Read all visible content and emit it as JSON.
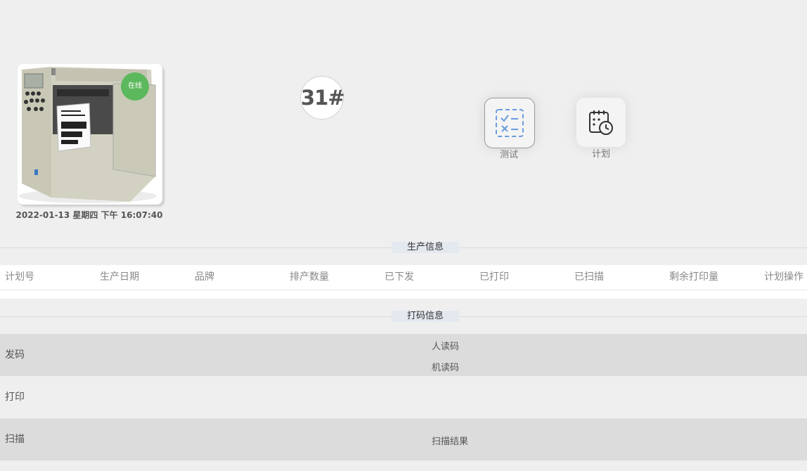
{
  "device": {
    "status": "在线",
    "datetime": "2022-01-13 星期四 下午 16:07:40",
    "machine_no": "31#"
  },
  "actions": [
    {
      "label": "测试",
      "icon": "checklist-icon"
    },
    {
      "label": "计划",
      "icon": "calendar-clock-icon"
    }
  ],
  "production": {
    "title": "生产信息",
    "columns": [
      "计划号",
      "生产日期",
      "品牌",
      "排产数量",
      "已下发",
      "已打印",
      "已扫描",
      "剩余打印量",
      "计划操作"
    ]
  },
  "coding": {
    "title": "打码信息",
    "rows": [
      {
        "label": "发码",
        "subs": [
          "人读码",
          "机读码"
        ]
      },
      {
        "label": "打印",
        "subs": []
      },
      {
        "label": "扫描",
        "subs": [
          "扫描结果"
        ]
      }
    ]
  },
  "colors": {
    "online": "#5cb85c",
    "accent_blue": "#6a9be0"
  }
}
